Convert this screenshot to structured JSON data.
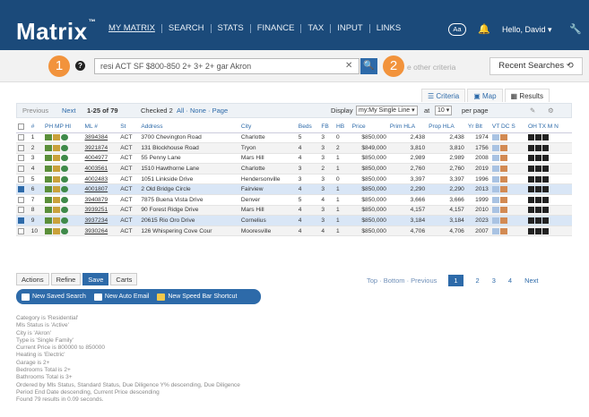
{
  "header": {
    "logo": "Matrix",
    "logo_mark": "™",
    "nav": [
      "MY MATRIX",
      "SEARCH",
      "STATS",
      "FINANCE",
      "TAX",
      "INPUT",
      "LINKS"
    ],
    "text_size_label": "Aa",
    "user_menu": "Hello, David ▾",
    "icons": [
      "bell-icon",
      "wrench-icon"
    ]
  },
  "search": {
    "badge1": "1",
    "badge2": "2",
    "help_glyph": "?",
    "query": "resi ACT SF $800-850 2+ 3+ 2+ gar Akron",
    "hint": "e other criteria",
    "recent_label": "Recent Searches ⟲"
  },
  "view_tabs": [
    "Criteria",
    "Map",
    "Results"
  ],
  "toolbar": {
    "previous": "Previous",
    "next": "Next",
    "range": "1-25 of 79",
    "checked": "Checked 2",
    "select_links": "All · None · Page",
    "display_label": "Display",
    "display_value": "my:My Single Line ▾",
    "at_label": "at",
    "per_page_value": "10 ▾",
    "per_page_label": "per page"
  },
  "table": {
    "headers": [
      "",
      "#",
      "PH MP HI",
      "ML #",
      "St",
      "Address",
      "City",
      "Beds",
      "FB",
      "HB",
      "Price",
      "Prim HLA",
      "Prop HLA",
      "Yr Blt",
      "VT DC S",
      "OH TX M N"
    ],
    "rows": [
      {
        "n": "1",
        "ml": "3894384",
        "st": "ACT",
        "address": "3700 Chevington Road",
        "city": "Charlotte",
        "beds": "5",
        "fb": "3",
        "hb": "0",
        "price": "$850,000",
        "prim": "2,438",
        "prop": "2,438",
        "yr": "1974",
        "checked": false
      },
      {
        "n": "2",
        "ml": "3921874",
        "st": "ACT",
        "address": "131 Blockhouse Road",
        "city": "Tryon",
        "beds": "4",
        "fb": "3",
        "hb": "2",
        "price": "$849,000",
        "prim": "3,810",
        "prop": "3,810",
        "yr": "1756",
        "checked": false
      },
      {
        "n": "3",
        "ml": "4004977",
        "st": "ACT",
        "address": "55 Penny Lane",
        "city": "Mars Hill",
        "beds": "4",
        "fb": "3",
        "hb": "1",
        "price": "$850,000",
        "prim": "2,989",
        "prop": "2,989",
        "yr": "2008",
        "checked": false
      },
      {
        "n": "4",
        "ml": "4003561",
        "st": "ACT",
        "address": "1510 Hawthorne Lane",
        "city": "Charlotte",
        "beds": "3",
        "fb": "2",
        "hb": "1",
        "price": "$850,000",
        "prim": "2,760",
        "prop": "2,760",
        "yr": "2019",
        "checked": false
      },
      {
        "n": "5",
        "ml": "4002483",
        "st": "ACT",
        "address": "1051 Linkside Drive",
        "city": "Hendersonville",
        "beds": "3",
        "fb": "3",
        "hb": "0",
        "price": "$850,000",
        "prim": "3,397",
        "prop": "3,397",
        "yr": "1996",
        "checked": false
      },
      {
        "n": "6",
        "ml": "4001807",
        "st": "ACT",
        "address": "2 Old Bridge Circle",
        "city": "Fairview",
        "beds": "4",
        "fb": "3",
        "hb": "1",
        "price": "$850,000",
        "prim": "2,290",
        "prop": "2,290",
        "yr": "2013",
        "checked": true
      },
      {
        "n": "7",
        "ml": "3940879",
        "st": "ACT",
        "address": "7875 Buena Vista Drive",
        "city": "Denver",
        "beds": "5",
        "fb": "4",
        "hb": "1",
        "price": "$850,000",
        "prim": "3,666",
        "prop": "3,666",
        "yr": "1999",
        "checked": false
      },
      {
        "n": "8",
        "ml": "3939251",
        "st": "ACT",
        "address": "90 Forest Ridge Drive",
        "city": "Mars Hill",
        "beds": "4",
        "fb": "3",
        "hb": "1",
        "price": "$850,000",
        "prim": "4,157",
        "prop": "4,157",
        "yr": "2010",
        "checked": false
      },
      {
        "n": "9",
        "ml": "3937234",
        "st": "ACT",
        "address": "20615 Rio Oro Drive",
        "city": "Cornelius",
        "beds": "4",
        "fb": "3",
        "hb": "1",
        "price": "$850,000",
        "prim": "3,184",
        "prop": "3,184",
        "yr": "2023",
        "checked": true
      },
      {
        "n": "10",
        "ml": "3930264",
        "st": "ACT",
        "address": "126 Whispering Cove Cour",
        "city": "Mooresville",
        "beds": "4",
        "fb": "4",
        "hb": "1",
        "price": "$850,000",
        "prim": "4,706",
        "prop": "4,706",
        "yr": "2007",
        "checked": false
      }
    ]
  },
  "pagination": {
    "top_bottom": "Top · Bottom · Previous",
    "pages": [
      "1",
      "2",
      "3",
      "4"
    ],
    "current": "1",
    "next": "Next"
  },
  "actions": {
    "tabs": [
      "Actions",
      "Refine",
      "Save",
      "Carts"
    ],
    "active_tab": "Save",
    "buttons": [
      "New Saved Search",
      "New Auto Email",
      "New Speed Bar Shortcut"
    ]
  },
  "criteria_summary": [
    "Category is 'Residential'",
    "Mls Status is 'Active'",
    "City is 'Akron'",
    "Type is 'Single Family'",
    "Current Price is 800000 to 850000",
    "Heating is 'Electric'",
    "Garage is 2+",
    "Bedrooms Total is 2+",
    "Bathrooms Total is 3+",
    "Ordered by Mls Status, Standard Status, Due Diligence Y% descending, Due Diligence",
    "Period End Date descending, Current Price descending",
    "Found 79 results in 0.09 seconds."
  ],
  "colors": {
    "header_bg": "#1b4a7a",
    "accent": "#2d6aa9",
    "badge": "#f2933c",
    "status_green": "#2f8f3a"
  }
}
